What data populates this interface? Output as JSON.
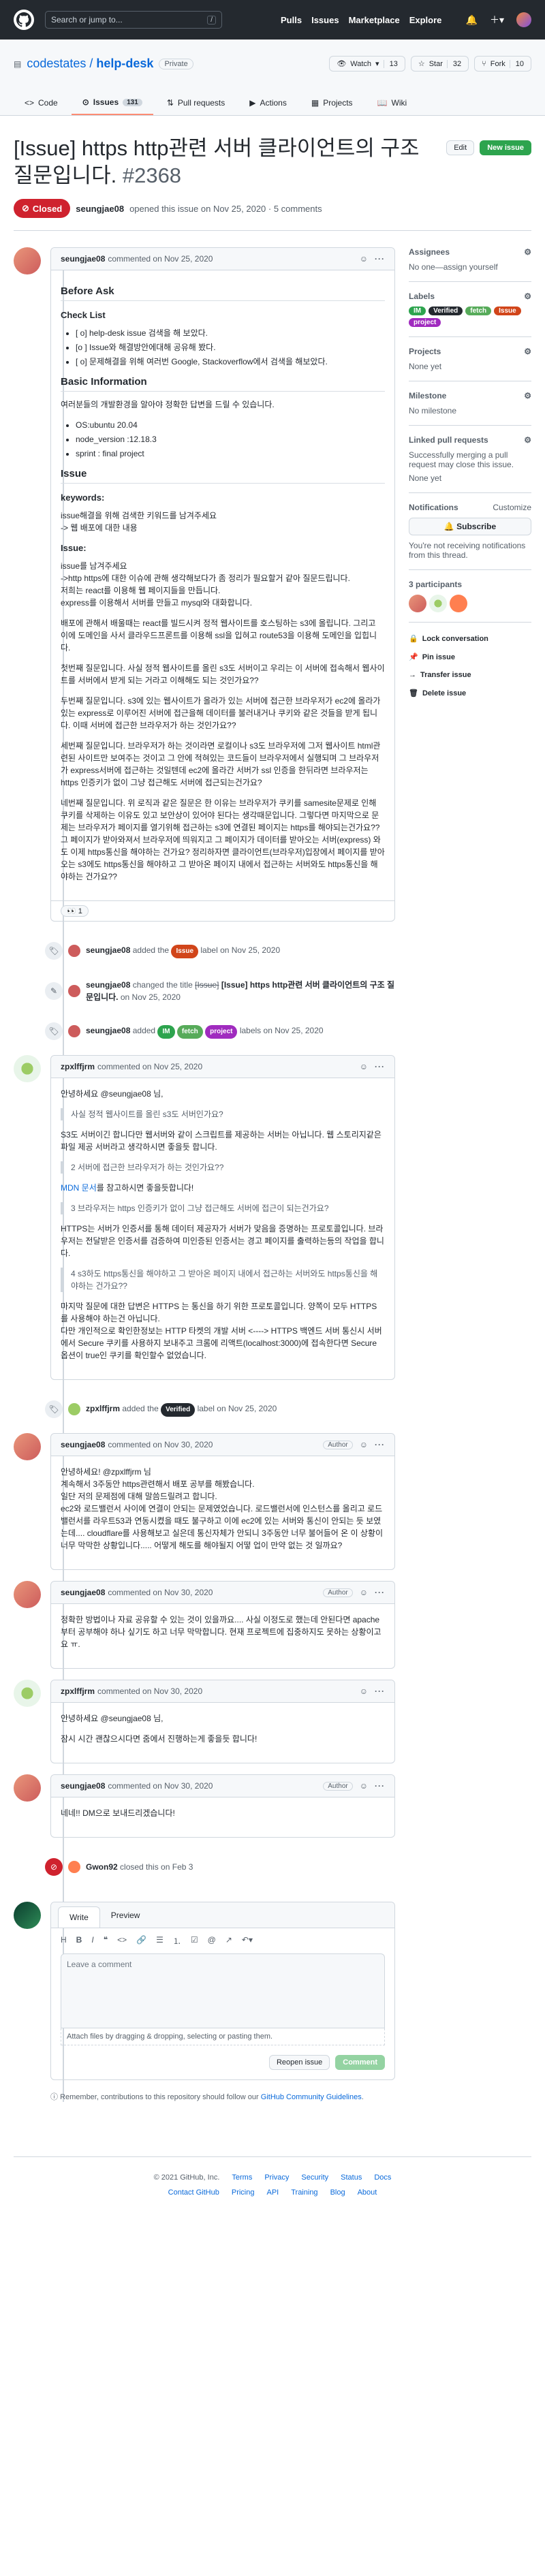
{
  "header": {
    "search_placeholder": "Search or jump to...",
    "search_key": "/",
    "nav": [
      "Pulls",
      "Issues",
      "Marketplace",
      "Explore"
    ]
  },
  "repo": {
    "owner": "codestates",
    "name": "help-desk",
    "visibility": "Private",
    "watch_label": "Watch",
    "watch_count": "13",
    "star_label": "Star",
    "star_count": "32",
    "fork_label": "Fork",
    "fork_count": "10",
    "tabs": [
      {
        "label": "Code"
      },
      {
        "label": "Issues",
        "count": "131"
      },
      {
        "label": "Pull requests"
      },
      {
        "label": "Actions"
      },
      {
        "label": "Projects"
      },
      {
        "label": "Wiki"
      }
    ]
  },
  "issue": {
    "title": "[Issue] https http관련 서버 클라이언트의 구조 질문입니다.",
    "number": "#2368",
    "edit_label": "Edit",
    "new_issue_label": "New issue",
    "status": "Closed",
    "opened_by": "seungjae08",
    "opened_text": "opened this issue on Nov 25, 2020 · 5 comments"
  },
  "first_comment": {
    "author": "seungjae08",
    "meta": "commented on Nov 25, 2020",
    "h_before_ask": "Before Ask",
    "h_checklist": "Check List",
    "checklist": [
      "[ o] help-desk issue 검색을 해 보았다.",
      "[o ] Issue와 해결방안에대해 공유해 봤다.",
      "[ o] 문제해결을 위해 여러번 Google, Stackoverflow에서 검색을 해보았다."
    ],
    "h_basic": "Basic Information",
    "basic_intro": "여러분들의 개발환경을 알아야 정확한 답변을 드릴 수 있습니다.",
    "basic_list": [
      "OS:ubuntu 20.04",
      "node_version :12.18.3",
      "sprint : final project"
    ],
    "h_issue": "Issue",
    "h_keywords": "keywords:",
    "keywords_text": "issue해결을 위해 검색한 키워드를 남겨주세요\n-> 웹 배포에 대한 내용",
    "h_issue2": "Issue:",
    "p1": "issue를 남겨주세요\n->http https에 대한 이슈에 관해 생각해보다가 좀 정리가 필요할거 같아 질문드립니다.\n저희는 react를 이용해 웹 페이지들을 만듭니다.\nexpress를 이용해서 서버를 만들고 mysql와 대화합니다.",
    "p2": "배포에 관해서 배울때는 react를 빌드시켜 정적 웹사이트를 호스팅하는 s3에 올립니다. 그리고 이에 도메인을 사서 클라우드프론트를 이용해 ssl을 입혀고 route53을 이용해 도메인을 입힙니다.",
    "p3": "첫번째 질문입니다. 사실 정적 웹사이트를 올린 s3도 서버이고 우리는 이 서버에 접속해서 웹사이트를 서버에서 받게 되는 거라고 이해해도 되는 것인가요??",
    "p4": "두번째 질문입니다. s3에 있는 웹사이트가 올라가 있는 서버에 접근한 브라우저가 ec2에 올라가있는 express로 이루어진 서버에 접근을해 데이터를 불러내거나 쿠키와 같은 것들을 받게 됩니다. 이때 서버에 접근한 브라우저가 하는 것인가요??",
    "p5": "세번째 질문입니다. 브라우저가 하는 것이라면 로컬이나 s3도 브라우저에 그저 웹사이트 html관련된 사이트만 보여주는 것이고 그 안에 적혀있는 코드들이 브라우저에서 실행되며 그 브라우저가 express서버에 접근하는 것일텐데 ec2에 올라간 서버가 ssl 인증을 한뒤라면 브라우저는 https 인증키가 없이 그냥 접근해도 서버에 접근되는건가요?",
    "p6": "네번째 질문입니다. 위 로직과 같은 질문은 한 이유는 브라우저가 쿠키를 samesite문제로 인해 쿠키를 삭제하는 이유도 있고 보안상이 있어야 된다는 생각때문입니다. 그렇다면 마지막으로 문제는 브라우저가 페이지를 열기위해 접근하는 s3에 연결된 페이지는 https를 해야되는건가요?? 그 페이지가 받아와져서 브라우저에 띄워지고 그 페이지가 데이터를 받아오는 서버(express) 와 도 이제 https통신을 해야하는 건가요? 정리하자면 클라이언트(브라우저)입장에서 페이지를 받아오는 s3에도 https통신을 해야하고 그 받아온 페이지 내에서 접근하는 서버와도 https통신을 해야하는 건가요??",
    "reaction_count": "1"
  },
  "events": {
    "label_added_1": {
      "user": "seungjae08",
      "pre": "added the",
      "label": "Issue",
      "post": "label on Nov 25, 2020"
    },
    "title_changed": {
      "user": "seungjae08",
      "pre": "changed the title",
      "old": "[Issue]",
      "new_title": "[Issue] https http관련 서버 클라이언트의 구조 질문입니다.",
      "post": "on Nov 25, 2020"
    },
    "labels_added_2": {
      "user": "seungjae08",
      "pre": "added",
      "labels": [
        "IM",
        "fetch",
        "project"
      ],
      "post": "labels on Nov 25, 2020"
    },
    "label_added_3": {
      "user": "zpxlffjrm",
      "pre": "added the",
      "label": "Verified",
      "post": "label on Nov 25, 2020"
    },
    "closed": {
      "user": "Gwon92",
      "text": "closed this on Feb 3"
    }
  },
  "comment2": {
    "author": "zpxlffjrm",
    "meta": "commented on Nov 25, 2020",
    "greet": "안녕하세요 @seungjae08 님,",
    "q1": "사실 정적 웹사이트를 올린 s3도 서버인가요?",
    "a1": "S3도 서버이긴 합니다만 웹서버와 같이 스크립트를 제공하는 서버는 아닙니다. 웹 스토리지같은 파일 제공 서버라고 생각하시면 좋을듯 합니다.",
    "q2": "2 서버에 접근한 브라우저가 하는 것인가요??",
    "a2_link": "MDN 문서",
    "a2": "를 참고하시면 좋을듯합니다!",
    "q3": "3 브라우저는 https 인증키가 없이 그냥 접근해도 서버에 접근이 되는건가요?",
    "a3": "HTTPS는 서버가 인증서를 통해 데이터 제공자가 서버가 맞음을 증명하는 프로토콜입니다. 브라우저는 전달받은 인증서를 검증하여 미인증된 인증서는 경고 페이지를 출력하는등의 작업을 합니다.",
    "q4": "4 s3하도 https통신을 해야하고 그 받아온 페이지 내에서 접근하는 서버와도 https통신을 해야하는 건가요??",
    "a4": "마지막 질문에 대한 답변은 HTTPS 는 통신을 하기 위한 프로토콜입니다. 양쪽이 모두 HTTPS 를 사용해야 하는건 아닙니다.\n다만 개인적으로 확인한정보는 HTTP 타켓의 개발 서버 <----> HTTPS 백엔드 서버 통신시 서버에서 Secure 쿠키를 사용하지 보내주고 크롬에 리액트(localhost:3000)에 접속한다면 Secure 옵션이 true인 쿠키를 확인할수 없었습니다."
  },
  "comment3": {
    "author": "seungjae08",
    "meta": "commented on Nov 30, 2020",
    "badge": "Author",
    "text": "안녕하세요! @zpxlffjrm 님\n계속해서 3주동안 https관련해서 배포 공부를 해봤습니다.\n일단 저의 문제점에 대해 말씀드릴려고 합니다.\nec2와 로드밸런서 사이에 연결이 안되는 문제였었습니다. 로드밸런서에 인스턴스를 올리고 로드밸런서를 라우트53과 연동시켰을 때도 불구하고 이에 ec2에 있는 서버와 통신이 안되는 듯 보였는데.... cloudflare를 사용해보고 실은데 통신자체가 안되니 3주동안 너무 불어들어 온 이 상황이 너무 막막한 상황입니다..... 어떻게 해도를 해야될지 어떻 업이 만약 없는 것 일까요?"
  },
  "comment4": {
    "author": "seungjae08",
    "meta": "commented on Nov 30, 2020",
    "badge": "Author",
    "text": "정확한 방법이나 자료 공유할 수 있는 것이 있을까요.... 사실 이정도로 했는데 안된다면 apache부터 공부해야 하나 싶기도 하고 너무 막막합니다. 현재 프로젝트에 집중하지도 못하는 상황이고요 ㅠ."
  },
  "comment5": {
    "author": "zpxlffjrm",
    "meta": "commented on Nov 30, 2020",
    "greet": "안녕하세요 @seungjae08 님,",
    "text": "잠시 시간 괜찮으시다면 줌에서 진행하는게 좋을듯 합니다!"
  },
  "comment6": {
    "author": "seungjae08",
    "meta": "commented on Nov 30, 2020",
    "badge": "Author",
    "text": "네네!! DM으로 보내드리겠습니다!"
  },
  "editor": {
    "tab_write": "Write",
    "tab_preview": "Preview",
    "placeholder": "Leave a comment",
    "attach_text": "Attach files by dragging & dropping, selecting or pasting them.",
    "reopen_label": "Reopen issue",
    "comment_label": "Comment",
    "reminder_pre": "Remember, contributions to this repository should follow our",
    "reminder_link": "GitHub Community Guidelines",
    "reminder_post": "."
  },
  "sidebar": {
    "assignees_title": "Assignees",
    "assignees_value": "No one—assign yourself",
    "labels_title": "Labels",
    "labels": [
      {
        "name": "IM",
        "color": "#2da44e",
        "text": "#fff"
      },
      {
        "name": "Verified",
        "color": "#24292f",
        "text": "#fff"
      },
      {
        "name": "fetch",
        "color": "#57ab5a",
        "text": "#fff"
      },
      {
        "name": "Issue",
        "color": "#d1451a",
        "text": "#fff"
      },
      {
        "name": "project",
        "color": "#a02bbf",
        "text": "#fff"
      }
    ],
    "projects_title": "Projects",
    "projects_value": "None yet",
    "milestone_title": "Milestone",
    "milestone_value": "No milestone",
    "linked_title": "Linked pull requests",
    "linked_value": "Successfully merging a pull request may close this issue.",
    "linked_none": "None yet",
    "notifications_title": "Notifications",
    "notifications_customize": "Customize",
    "subscribe_label": "Subscribe",
    "notifications_text": "You're not receiving notifications from this thread.",
    "participants_title": "3 participants",
    "lock": "Lock conversation",
    "pin": "Pin issue",
    "transfer": "Transfer issue",
    "delete": "Delete issue"
  },
  "footer": {
    "copyright": "© 2021 GitHub, Inc.",
    "row1": [
      "Terms",
      "Privacy",
      "Security",
      "Status",
      "Docs"
    ],
    "row2": [
      "Contact GitHub",
      "Pricing",
      "API",
      "Training",
      "Blog",
      "About"
    ]
  }
}
